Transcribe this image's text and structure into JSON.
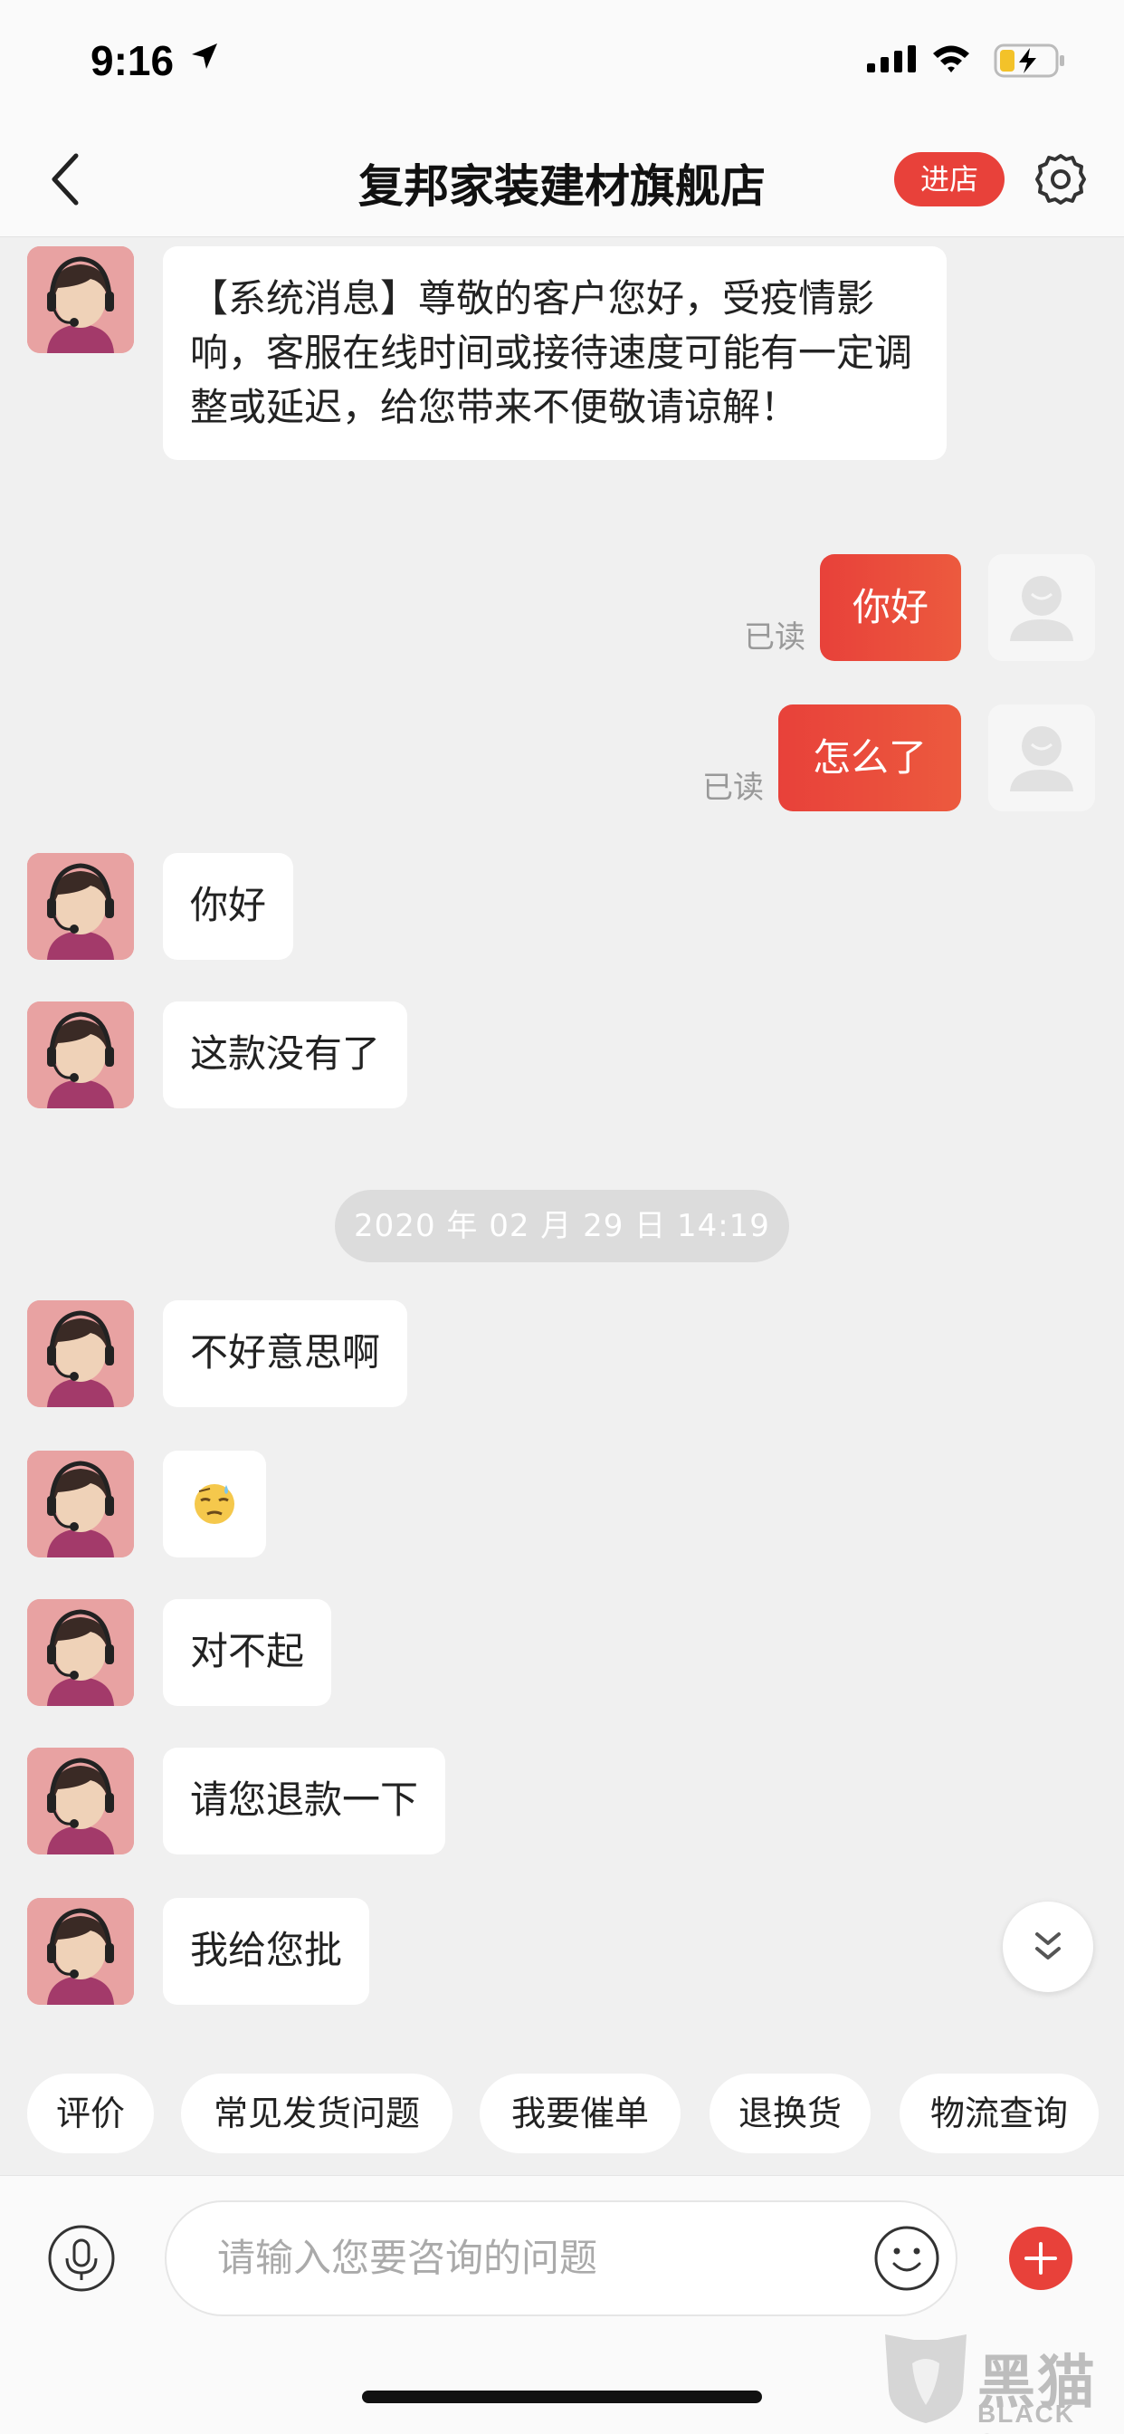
{
  "status_bar": {
    "time": "9:16"
  },
  "header": {
    "title": "复邦家装建材旗舰店",
    "enter_label": "进店"
  },
  "messages": [
    {
      "from": "shop",
      "text": "【系统消息】尊敬的客户您好，受疫情影响，客服在线时间或接待速度可能有一定调整或延迟，给您带来不便敬请谅解！"
    },
    {
      "from": "me",
      "text": "你好",
      "status": "已读"
    },
    {
      "from": "me",
      "text": "怎么了",
      "status": "已读"
    },
    {
      "from": "shop",
      "text": "你好"
    },
    {
      "from": "shop",
      "text": "这款没有了"
    },
    {
      "from": "shop",
      "text": "不好意思啊"
    },
    {
      "from": "shop",
      "text": "",
      "emoji": "😓"
    },
    {
      "from": "shop",
      "text": "对不起"
    },
    {
      "from": "shop",
      "text": "请您退款一下"
    },
    {
      "from": "shop",
      "text": "我给您批"
    }
  ],
  "timestamp": "2020 年 02 月 29 日  14:19",
  "quick_replies": [
    "评价",
    "常见发货问题",
    "我要催单",
    "退换货",
    "物流查询"
  ],
  "input": {
    "placeholder": "请输入您要咨询的问题"
  },
  "watermark": {
    "text": "黑猫",
    "sub": "BLACK CAT"
  },
  "colors": {
    "accent": "#e8413a",
    "background": "#f0f0f0",
    "bubble": "#ffffff"
  },
  "icons": [
    "location-arrow-icon",
    "signal-icon",
    "wifi-icon",
    "battery-charging-icon",
    "back-arrow-icon",
    "gear-icon",
    "chevron-double-down-icon",
    "microphone-icon",
    "smile-icon",
    "plus-icon"
  ]
}
